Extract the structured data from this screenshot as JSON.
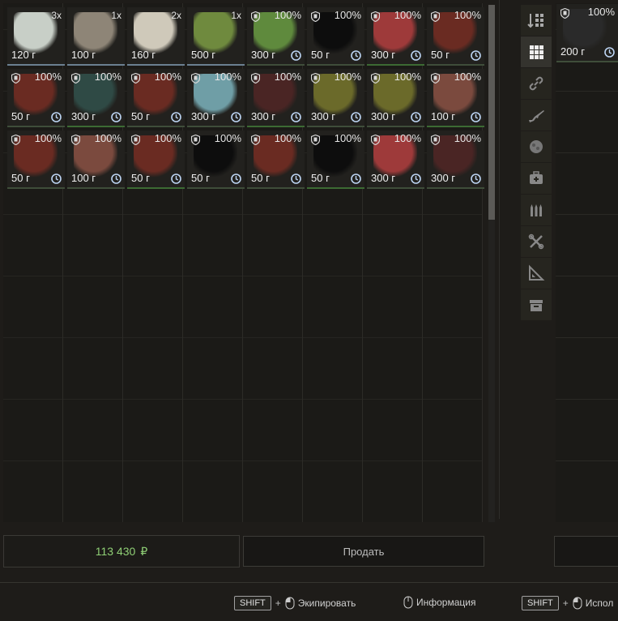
{
  "stash_items": [
    {
      "name": "Russian money stack",
      "qty": "3x",
      "price": "120 г",
      "color": "#c8cfc7",
      "type": "qty"
    },
    {
      "name": "Bandage roll",
      "qty": "1x",
      "price": "100 г",
      "color": "#8e8577",
      "type": "qty"
    },
    {
      "name": "Toilet paper",
      "qty": "2x",
      "price": "160 г",
      "color": "#cfc9ba",
      "type": "qty"
    },
    {
      "name": "Green canister",
      "qty": "1x",
      "price": "500 г",
      "color": "#6f8a3e",
      "type": "qty"
    },
    {
      "name": "Green crystal",
      "dur": "100%",
      "price": "300 г",
      "color": "#5f8a3d",
      "type": "artifact"
    },
    {
      "name": "Black shard",
      "dur": "100%",
      "price": "50 г",
      "color": "#0d0d0d",
      "type": "artifact"
    },
    {
      "name": "Red crystal",
      "dur": "100%",
      "price": "300 г",
      "color": "#9e3a3a",
      "type": "artifact"
    },
    {
      "name": "Red rock",
      "dur": "100%",
      "price": "50 г",
      "color": "#6a2b22",
      "type": "artifact"
    },
    {
      "name": "Red rock",
      "dur": "100%",
      "price": "50 г",
      "color": "#6a2b22",
      "type": "artifact"
    },
    {
      "name": "Teal flower",
      "dur": "100%",
      "price": "300 г",
      "color": "#2f4a45",
      "type": "artifact"
    },
    {
      "name": "Red rock",
      "dur": "100%",
      "price": "50 г",
      "color": "#6a2b22",
      "type": "artifact"
    },
    {
      "name": "Blue crystal",
      "dur": "100%",
      "price": "300 г",
      "color": "#6f9ea6",
      "type": "artifact"
    },
    {
      "name": "Dark red rock",
      "dur": "100%",
      "price": "300 г",
      "color": "#4a2524",
      "type": "artifact"
    },
    {
      "name": "Yellow moss",
      "dur": "100%",
      "price": "300 г",
      "color": "#6b6a2a",
      "type": "artifact"
    },
    {
      "name": "Yellow moss",
      "dur": "100%",
      "price": "300 г",
      "color": "#6b6a2a",
      "type": "artifact"
    },
    {
      "name": "Flower bundle",
      "dur": "100%",
      "price": "100 г",
      "color": "#7b4a3e",
      "type": "artifact"
    },
    {
      "name": "Red rock",
      "dur": "100%",
      "price": "50 г",
      "color": "#6a2b22",
      "type": "artifact"
    },
    {
      "name": "Flower bundle",
      "dur": "100%",
      "price": "100 г",
      "color": "#7b4a3e",
      "type": "artifact"
    },
    {
      "name": "Red rock",
      "dur": "100%",
      "price": "50 г",
      "color": "#6a2b22",
      "type": "artifact"
    },
    {
      "name": "Black shard",
      "dur": "100%",
      "price": "50 г",
      "color": "#0d0d0d",
      "type": "artifact"
    },
    {
      "name": "Red rock",
      "dur": "100%",
      "price": "50 г",
      "color": "#6a2b22",
      "type": "artifact"
    },
    {
      "name": "Black shard",
      "dur": "100%",
      "price": "50 г",
      "color": "#0d0d0d",
      "type": "artifact"
    },
    {
      "name": "Red crystal",
      "dur": "100%",
      "price": "300 г",
      "color": "#9e3a3a",
      "type": "artifact"
    },
    {
      "name": "Dark red rock",
      "dur": "100%",
      "price": "300 г",
      "color": "#4a2524",
      "type": "artifact"
    }
  ],
  "right_item": {
    "name": "Dark shard",
    "dur": "100%",
    "price": "200 г",
    "color": "#2a2a2a"
  },
  "sidebar": [
    "sort-icon",
    "grid-icon",
    "link-icon",
    "rifle-icon",
    "artifact-icon",
    "medkit-icon",
    "ammo-icon",
    "tools-icon",
    "ruler-icon",
    "box-icon"
  ],
  "money": {
    "amount": "113 430",
    "currency": "₽"
  },
  "sell_label": "Продать",
  "hints": [
    {
      "key": "SHIFT",
      "label": "Экипировать"
    },
    {
      "label": "Информация"
    },
    {
      "key": "SHIFT",
      "label": "Испол"
    }
  ]
}
